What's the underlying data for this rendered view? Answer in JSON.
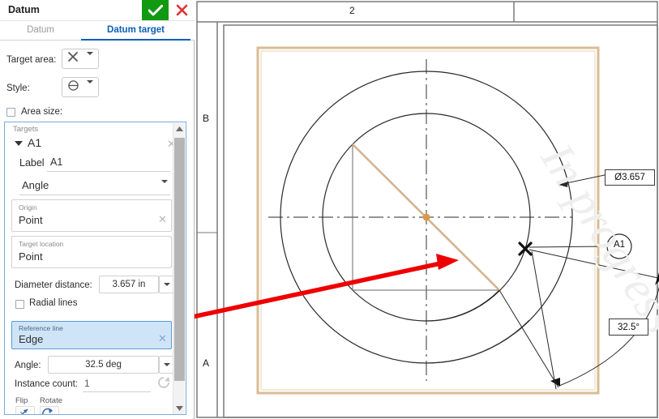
{
  "dialog": {
    "title": "Datum",
    "ok_label": "check-mark",
    "cancel_label": "x-mark",
    "tabs": [
      {
        "label": "Datum",
        "active": false
      },
      {
        "label": "Datum target",
        "active": true
      }
    ],
    "fields": {
      "target_area_label": "Target area:",
      "target_area_value": "✕",
      "style_label": "Style:",
      "style_value": "⊖",
      "area_size_label": "Area size:",
      "area_size_checked": false
    },
    "targets": {
      "group_label": "Targets",
      "item_name": "A1",
      "label_caption": "Label",
      "label_value": "A1",
      "type_value": "Angle",
      "origin_caption": "Origin",
      "origin_value": "Point",
      "target_location_caption": "Target location",
      "target_location_value": "Point",
      "diameter_caption": "Diameter distance:",
      "diameter_value": "3.657 in",
      "radial_lines_label": "Radial lines",
      "radial_lines_checked": false,
      "reference_line_caption": "Reference line",
      "reference_line_value": "Edge",
      "angle_caption": "Angle:",
      "angle_value": "32.5 deg",
      "instance_count_caption": "Instance count:",
      "instance_count_value": "1",
      "flip_label": "Flip",
      "rotate_label": "Rotate"
    }
  },
  "drawing": {
    "zone_top": "2",
    "zone_left_upper": "B",
    "zone_left_lower": "A",
    "diameter_callout": "Ø3.657",
    "datum_bubble": "A1",
    "angle_callout": "32.5°",
    "watermark": "In progress"
  },
  "colors": {
    "accent_blue": "#0a5fb4",
    "ok_green": "#119911",
    "cancel_red": "#e03131",
    "highlight_blue": "#cfe4f7",
    "sheet_tan": "#d9bc94",
    "reference_line_tan": "#d4b38c",
    "annotation_red": "#ee0000",
    "geometry_black": "#2a2a2a"
  }
}
